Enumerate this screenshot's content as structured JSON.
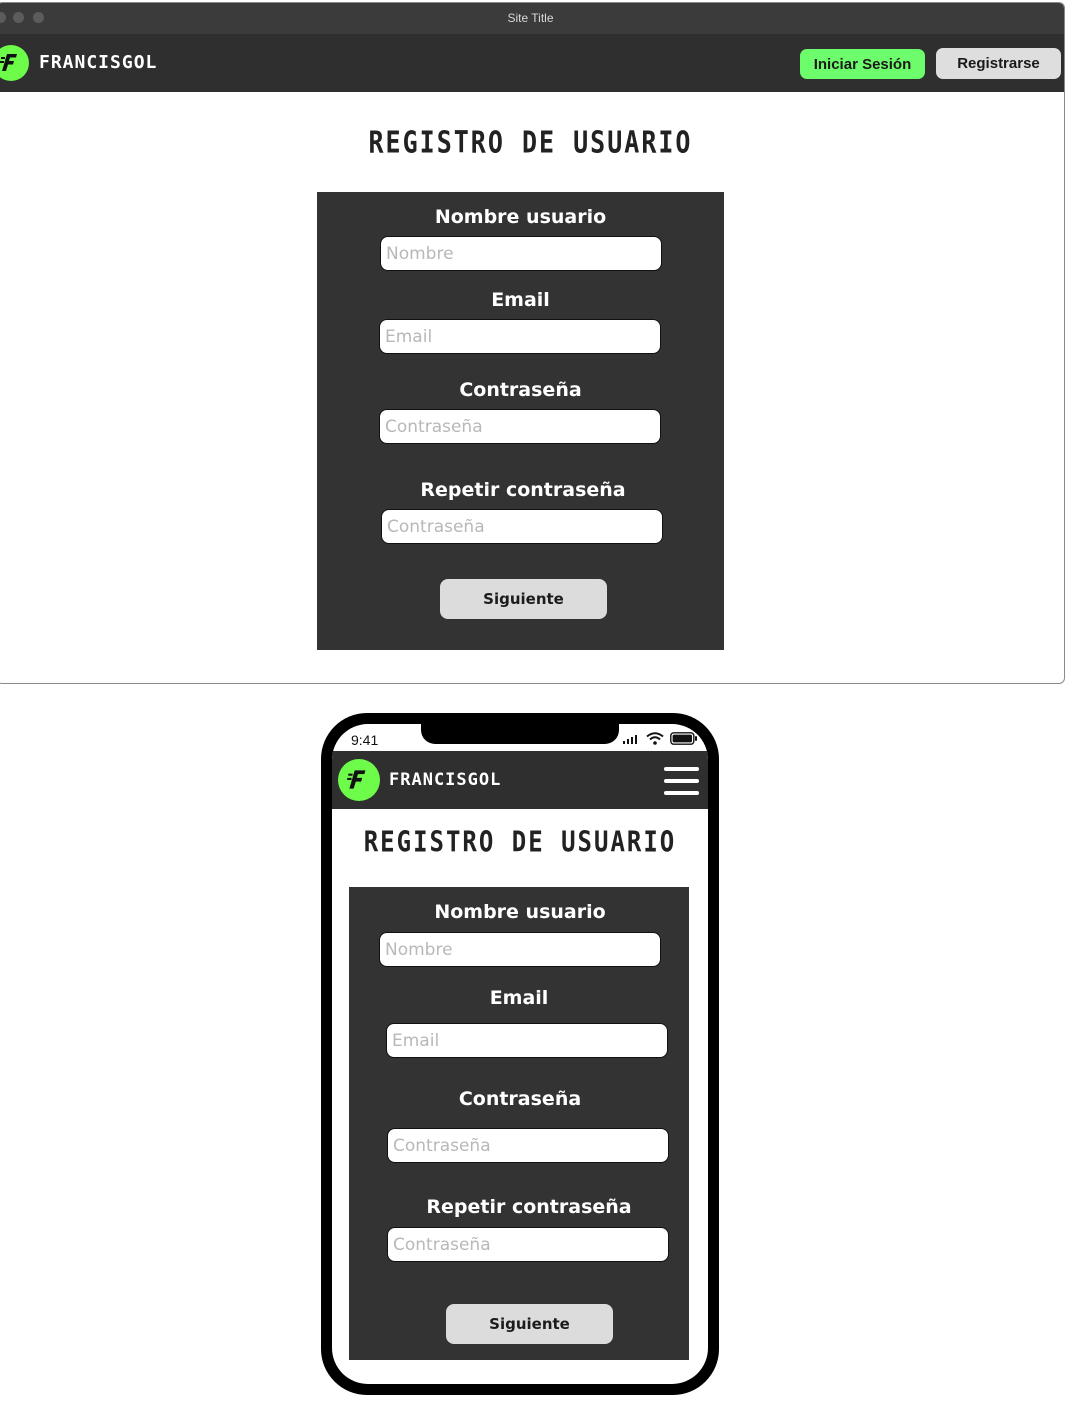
{
  "window": {
    "title": "Site Title"
  },
  "brand": {
    "name": "FRANCISGOL"
  },
  "header": {
    "login_label": "Iniciar Sesión",
    "register_label": "Registrarse"
  },
  "form": {
    "title": "REGISTRO DE USUARIO",
    "username_label": "Nombre usuario",
    "username_placeholder": "Nombre",
    "email_label": "Email",
    "email_placeholder": "Email",
    "password_label": "Contraseña",
    "password_placeholder": "Contraseña",
    "repeat_label": "Repetir contraseña",
    "repeat_placeholder": "Contraseña",
    "submit_label": "Siguiente"
  },
  "phone": {
    "time": "9:41"
  },
  "colors": {
    "accent": "#6dfc4a",
    "panel": "#333333",
    "nav": "#2f2f2f"
  },
  "icons": [
    "logo-icon",
    "signal-icon",
    "wifi-icon",
    "battery-icon",
    "hamburger-icon"
  ]
}
